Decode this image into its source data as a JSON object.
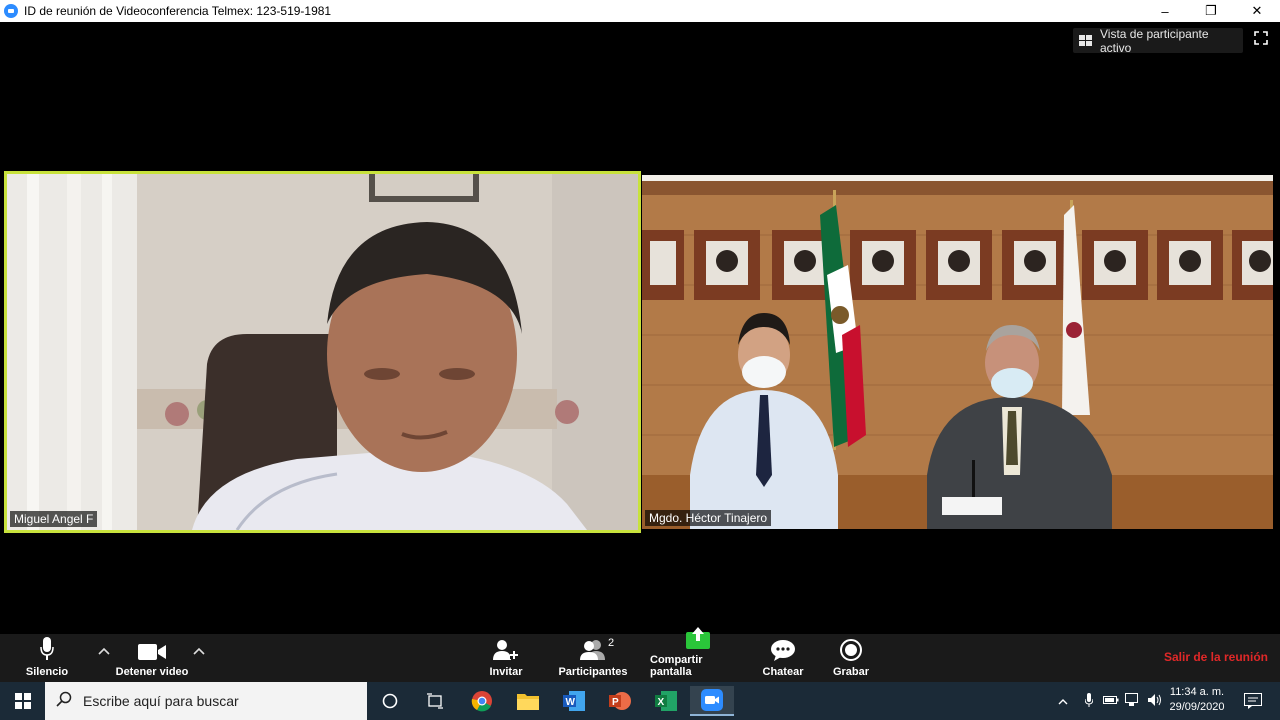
{
  "window": {
    "title": "ID de reunión de Videoconferencia Telmex: 123-519-1981",
    "minimize": "–",
    "restore": "❐",
    "close": "✕"
  },
  "view": {
    "active_speaker_label": "Vista de participante activo"
  },
  "participants": [
    {
      "name": "Miguel Angel F"
    },
    {
      "name": "Mgdo. Héctor Tinajero"
    }
  ],
  "toolbar": {
    "mute_label": "Silencio",
    "video_label": "Detener video",
    "invite_label": "Invitar",
    "participants_label": "Participantes",
    "participants_count": "2",
    "share_label": "Compartir pantalla",
    "chat_label": "Chatear",
    "record_label": "Grabar",
    "leave_label": "Salir de la reunión"
  },
  "taskbar": {
    "search_placeholder": "Escribe aquí para buscar",
    "time": "11:34 a. m.",
    "date": "29/09/2020"
  },
  "colors": {
    "active_speaker_border": "#c8e23c",
    "leave_red": "#e02828",
    "share_green": "#2ac63a"
  }
}
